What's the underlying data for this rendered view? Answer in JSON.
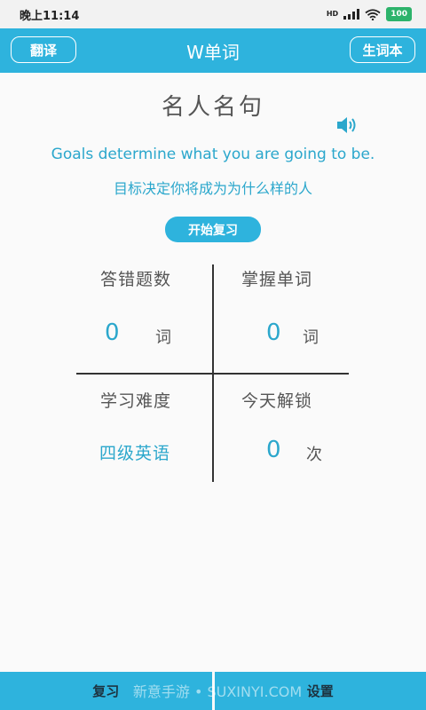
{
  "status": {
    "time": "晚上11:14",
    "network": "HD",
    "battery": "100"
  },
  "appbar": {
    "title": "W单词",
    "translate_label": "翻译",
    "vocab_label": "生词本"
  },
  "quote": {
    "heading": "名人名句",
    "english": "Goals determine what you are going to be.",
    "chinese": "目标决定你将成为为什么样的人"
  },
  "review_button": "开始复习",
  "stats": {
    "wrong": {
      "label": "答错题数",
      "value": "0",
      "unit": "词"
    },
    "mastered": {
      "label": "掌握单词",
      "value": "0",
      "unit": "词"
    },
    "difficulty": {
      "label": "学习难度",
      "value": "四级英语"
    },
    "unlock": {
      "label": "今天解锁",
      "value": "0",
      "unit": "次"
    }
  },
  "bottom": {
    "review": "复习",
    "settings": "设置"
  },
  "watermark": "新意手游 • SUXINYI.COM",
  "colors": {
    "accent": "#2eb3dd",
    "text_accent": "#2ba7cc"
  }
}
